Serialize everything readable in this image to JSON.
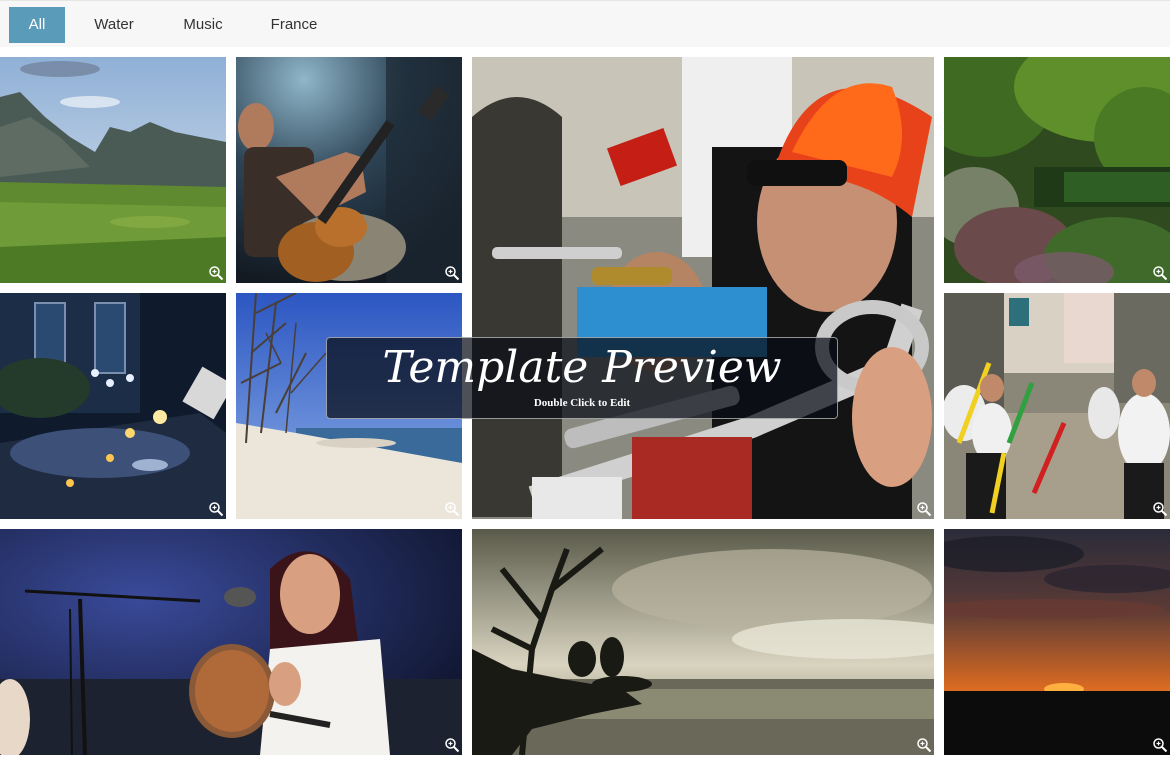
{
  "filters": [
    {
      "label": "All",
      "active": true
    },
    {
      "label": "Water",
      "active": false
    },
    {
      "label": "Music",
      "active": false
    },
    {
      "label": "France",
      "active": false
    }
  ],
  "gallery": [
    {
      "subject": "mountain meadow landscape",
      "icon": "zoom-in-icon"
    },
    {
      "subject": "guitarist on stage",
      "icon": "zoom-in-icon"
    },
    {
      "subject": "brass band performer with red feather headdress",
      "icon": "zoom-in-icon"
    },
    {
      "subject": "garden with trees and flowers",
      "icon": "zoom-in-icon"
    },
    {
      "subject": "candlelit terrace dinner at dusk",
      "icon": "zoom-in-icon"
    },
    {
      "subject": "sandy beach with bare trees",
      "icon": "zoom-in-icon"
    },
    {
      "subject": "street dancers with colored sticks",
      "icon": "zoom-in-icon"
    },
    {
      "subject": "singer with tambourine at microphone",
      "icon": "zoom-in-icon"
    },
    {
      "subject": "dramatic sky over lake with silhouetted trees",
      "icon": "zoom-in-icon"
    },
    {
      "subject": "orange sunset over dark horizon",
      "icon": "zoom-in-icon"
    }
  ],
  "overlay": {
    "title": "Template Preview",
    "subtitle": "Double Click to Edit"
  },
  "colors": {
    "accent": "#5b9bba",
    "filter_bar": "#f7f7f7",
    "overlay_bg": "#080c16"
  }
}
